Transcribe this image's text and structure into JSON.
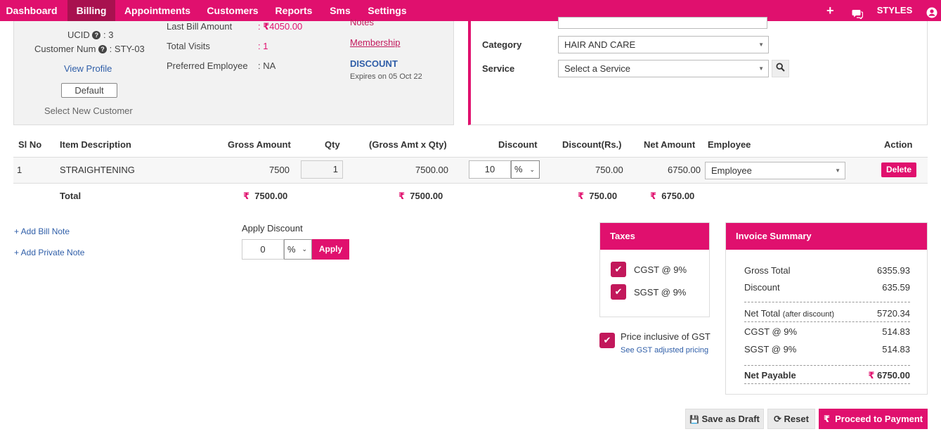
{
  "nav": {
    "items": [
      "Dashboard",
      "Billing",
      "Appointments",
      "Customers",
      "Reports",
      "Sms",
      "Settings"
    ],
    "brand": "STYLES"
  },
  "customer": {
    "ucid_label": "UCID",
    "ucid_value": ": 3",
    "num_label": "Customer Num",
    "num_value": ": STY-03",
    "view_profile": "View Profile",
    "default_btn": "Default",
    "select_new": "Select New Customer",
    "last_bill_label": "Last Bill Amount",
    "last_bill_value": "4050.00",
    "visits_label": "Total Visits",
    "visits_value": "1",
    "pref_emp_label": "Preferred Employee",
    "pref_emp_value": ": NA",
    "notes": "Notes",
    "membership": "Membership",
    "discount_title": "DISCOUNT",
    "discount_expiry": "Expires on 05 Oct 22"
  },
  "service": {
    "category_label": "Category",
    "category_value": "HAIR AND CARE",
    "service_label": "Service",
    "service_placeholder": "Select a Service"
  },
  "table": {
    "headers": [
      "Sl No",
      "Item Description",
      "Gross Amount",
      "Qty",
      "(Gross Amt x Qty)",
      "Discount",
      "Discount(Rs.)",
      "Net Amount",
      "Employee",
      "Action"
    ],
    "rows": [
      {
        "sl": "1",
        "desc": "STRAIGHTENING",
        "gross": "7500",
        "qty": "1",
        "gross_qty": "7500.00",
        "discount": "10",
        "discount_type": "%",
        "discount_rs": "750.00",
        "net": "6750.00",
        "employee": "Employee",
        "action": "Delete"
      }
    ],
    "total_label": "Total",
    "total_gross": "7500.00",
    "total_gross_qty": "7500.00",
    "total_discount": "750.00",
    "total_net": "6750.00"
  },
  "notes": {
    "bill_note": "+ Add Bill Note",
    "private_note": "+ Add Private Note"
  },
  "apply_discount": {
    "label": "Apply Discount",
    "value": "0",
    "type": "%",
    "button": "Apply"
  },
  "taxes": {
    "title": "Taxes",
    "items": [
      "CGST @ 9%",
      "SGST @ 9%"
    ],
    "price_inclusive": "Price inclusive of GST",
    "see_adjusted": "See GST adjusted pricing"
  },
  "summary": {
    "title": "Invoice Summary",
    "gross_total_label": "Gross Total",
    "gross_total": "6355.93",
    "discount_label": "Discount",
    "discount": "635.59",
    "net_total_label": "Net Total",
    "net_total_note": "(after discount)",
    "net_total": "5720.34",
    "cgst_label": "CGST @ 9%",
    "cgst": "514.83",
    "sgst_label": "SGST @ 9%",
    "sgst": "514.83",
    "net_payable_label": "Net Payable",
    "net_payable": "6750.00"
  },
  "actions": {
    "save_draft": "Save as Draft",
    "reset": "Reset",
    "proceed": "Proceed to Payment"
  },
  "colors": {
    "accent": "#e0106e",
    "nav_active": "#a8114f",
    "link": "#2f5ea8"
  },
  "icons": {
    "add": "plus-icon",
    "chat": "chat-icon",
    "user": "user-circle-icon",
    "search": "search-icon",
    "currency": "rupee-icon",
    "save": "floppy-icon",
    "reset": "refresh-icon",
    "check": "check-icon"
  }
}
